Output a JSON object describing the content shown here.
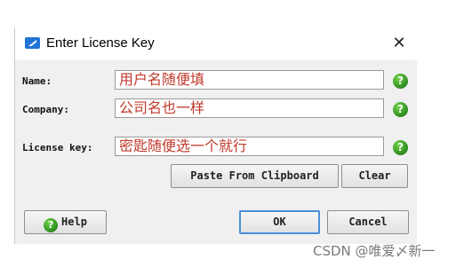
{
  "window": {
    "title": "Enter License Key",
    "close_glyph": "✕"
  },
  "form": {
    "name_label": "Name:",
    "name_value": "用户名随便填",
    "company_label": "Company:",
    "company_value": "公司名也一样",
    "license_label": "License key:",
    "license_value": "密匙随便选一个就行",
    "help_glyph": "?"
  },
  "buttons": {
    "paste": "Paste From Clipboard",
    "clear": "Clear",
    "help": "Help",
    "ok": "OK",
    "cancel": "Cancel"
  },
  "watermark": "CSDN @唯爱〆新一",
  "colors": {
    "field_text": "#c0392b",
    "help_green": "#2e8b1f",
    "default_border": "#4a90d9"
  }
}
